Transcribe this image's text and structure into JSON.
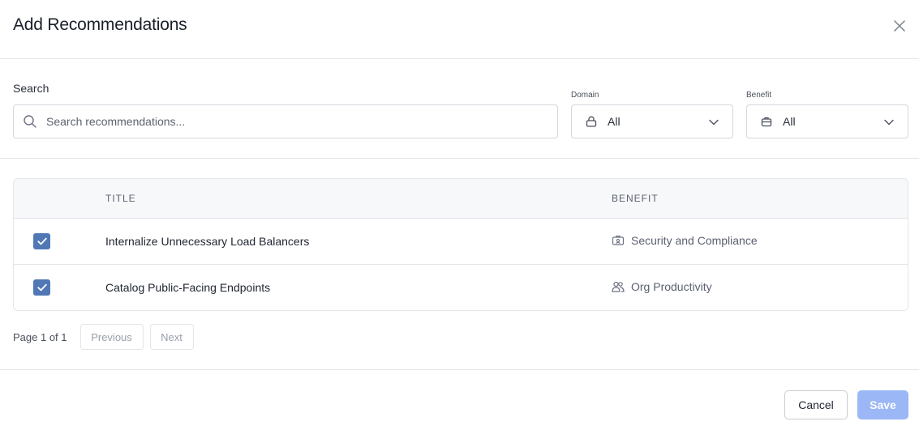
{
  "dialog": {
    "title": "Add Recommendations",
    "close_icon": "close-icon"
  },
  "filters": {
    "search": {
      "label": "Search",
      "placeholder": "Search recommendations...",
      "value": "",
      "icon": "search-icon"
    },
    "domain": {
      "label": "Domain",
      "value": "All",
      "icon": "lock-icon"
    },
    "benefit": {
      "label": "Benefit",
      "value": "All",
      "icon": "briefcase-icon"
    }
  },
  "table": {
    "columns": [
      "TITLE",
      "BENEFIT"
    ],
    "rows": [
      {
        "checked": true,
        "title": "Internalize Unnecessary Load Balancers",
        "benefit": "Security and Compliance",
        "benefit_icon": "id-badge-icon"
      },
      {
        "checked": true,
        "title": "Catalog Public-Facing Endpoints",
        "benefit": "Org Productivity",
        "benefit_icon": "users-icon"
      }
    ]
  },
  "pagination": {
    "info": "Page 1 of 1",
    "previous_label": "Previous",
    "next_label": "Next"
  },
  "footer": {
    "cancel_label": "Cancel",
    "save_label": "Save"
  },
  "colors": {
    "checkbox": "#5078b4",
    "save_disabled": "#9bb7f5",
    "border": "#e3e5e9"
  }
}
